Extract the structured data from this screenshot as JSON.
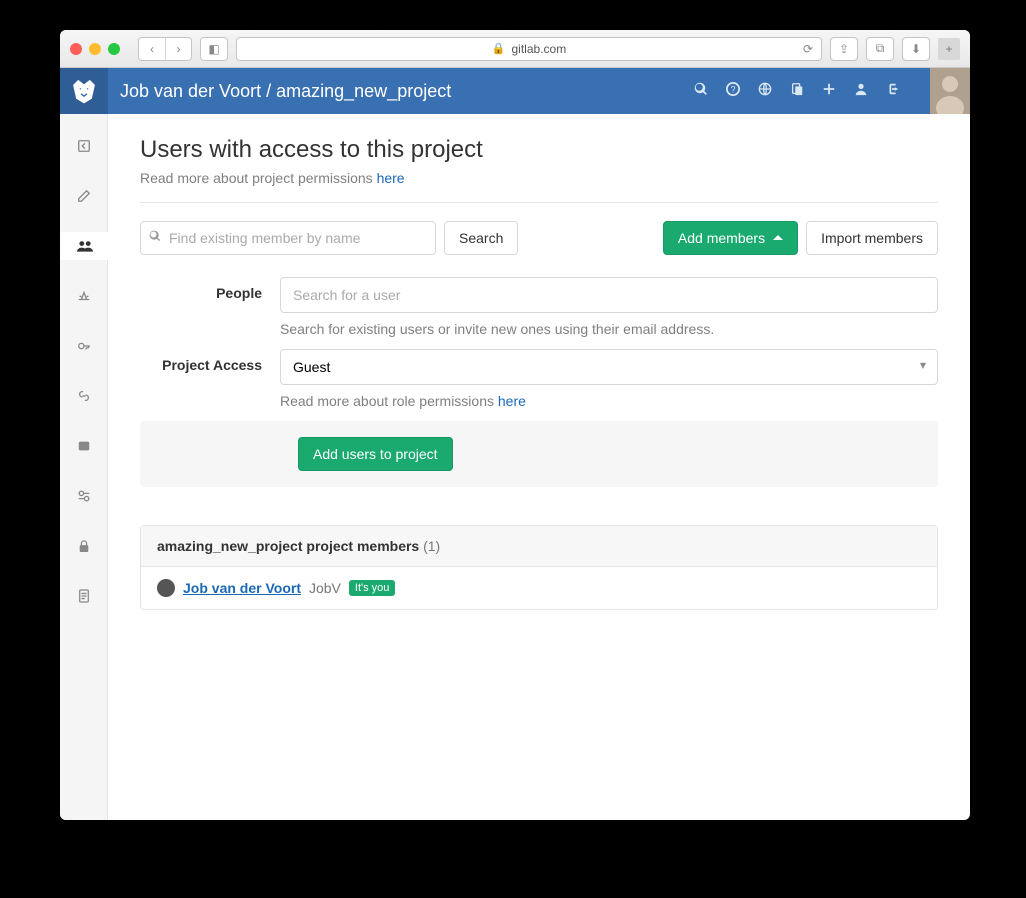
{
  "browser": {
    "url_host": "gitlab.com"
  },
  "header": {
    "breadcrumb_owner": "Job van der Voort",
    "breadcrumb_sep": " / ",
    "breadcrumb_project": "amazing_new_project"
  },
  "page": {
    "title": "Users with access to this project",
    "subtitle_prefix": "Read more about project permissions ",
    "subtitle_link": "here"
  },
  "toolbar": {
    "filter_placeholder": "Find existing member by name",
    "search_label": "Search",
    "add_members_label": "Add members",
    "import_members_label": "Import members"
  },
  "form": {
    "people_label": "People",
    "people_placeholder": "Search for a user",
    "people_help": "Search for existing users or invite new ones using their email address.",
    "access_label": "Project Access",
    "access_value": "Guest",
    "access_help_prefix": "Read more about role permissions ",
    "access_help_link": "here",
    "submit_label": "Add users to project"
  },
  "members": {
    "header_project": "amazing_new_project",
    "header_suffix": " project members ",
    "count": "(1)",
    "row": {
      "name": "Job van der Voort",
      "username": "JobV",
      "badge": "It's you"
    }
  }
}
